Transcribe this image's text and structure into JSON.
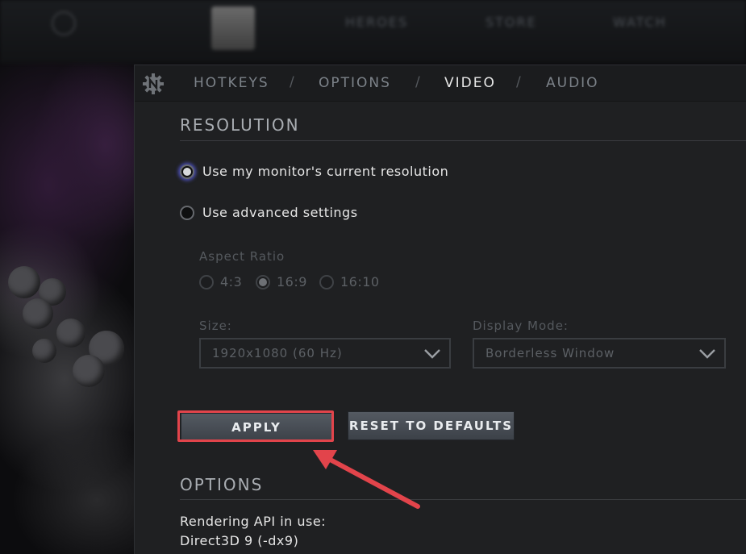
{
  "top_nav": {
    "items": [
      "HEROES",
      "STORE",
      "WATCH"
    ]
  },
  "tabs": [
    {
      "label": "HOTKEYS",
      "active": false
    },
    {
      "label": "OPTIONS",
      "active": false
    },
    {
      "label": "VIDEO",
      "active": true
    },
    {
      "label": "AUDIO",
      "active": false
    }
  ],
  "tab_separator": "/",
  "resolution": {
    "title": "RESOLUTION",
    "options": [
      {
        "label": "Use my monitor's current resolution",
        "checked": true
      },
      {
        "label": "Use advanced settings",
        "checked": false
      }
    ],
    "aspect_ratio": {
      "label": "Aspect Ratio",
      "options": [
        {
          "label": "4:3",
          "checked": false
        },
        {
          "label": "16:9",
          "checked": true
        },
        {
          "label": "16:10",
          "checked": false
        }
      ]
    },
    "size": {
      "label": "Size:",
      "value": "1920x1080 (60 Hz)"
    },
    "display_mode": {
      "label": "Display Mode:",
      "value": "Borderless Window"
    }
  },
  "buttons": {
    "apply": "APPLY",
    "reset": "RESET TO DEFAULTS"
  },
  "options": {
    "title": "OPTIONS",
    "rendering_api_label": "Rendering API in use:",
    "rendering_api_value": "Direct3D 9 (-dx9)"
  },
  "colors": {
    "panel_bg": "#1f2022",
    "highlight": "#e2444b",
    "active_tab": "#e8e8e8",
    "inactive_tab": "#7c8289"
  }
}
